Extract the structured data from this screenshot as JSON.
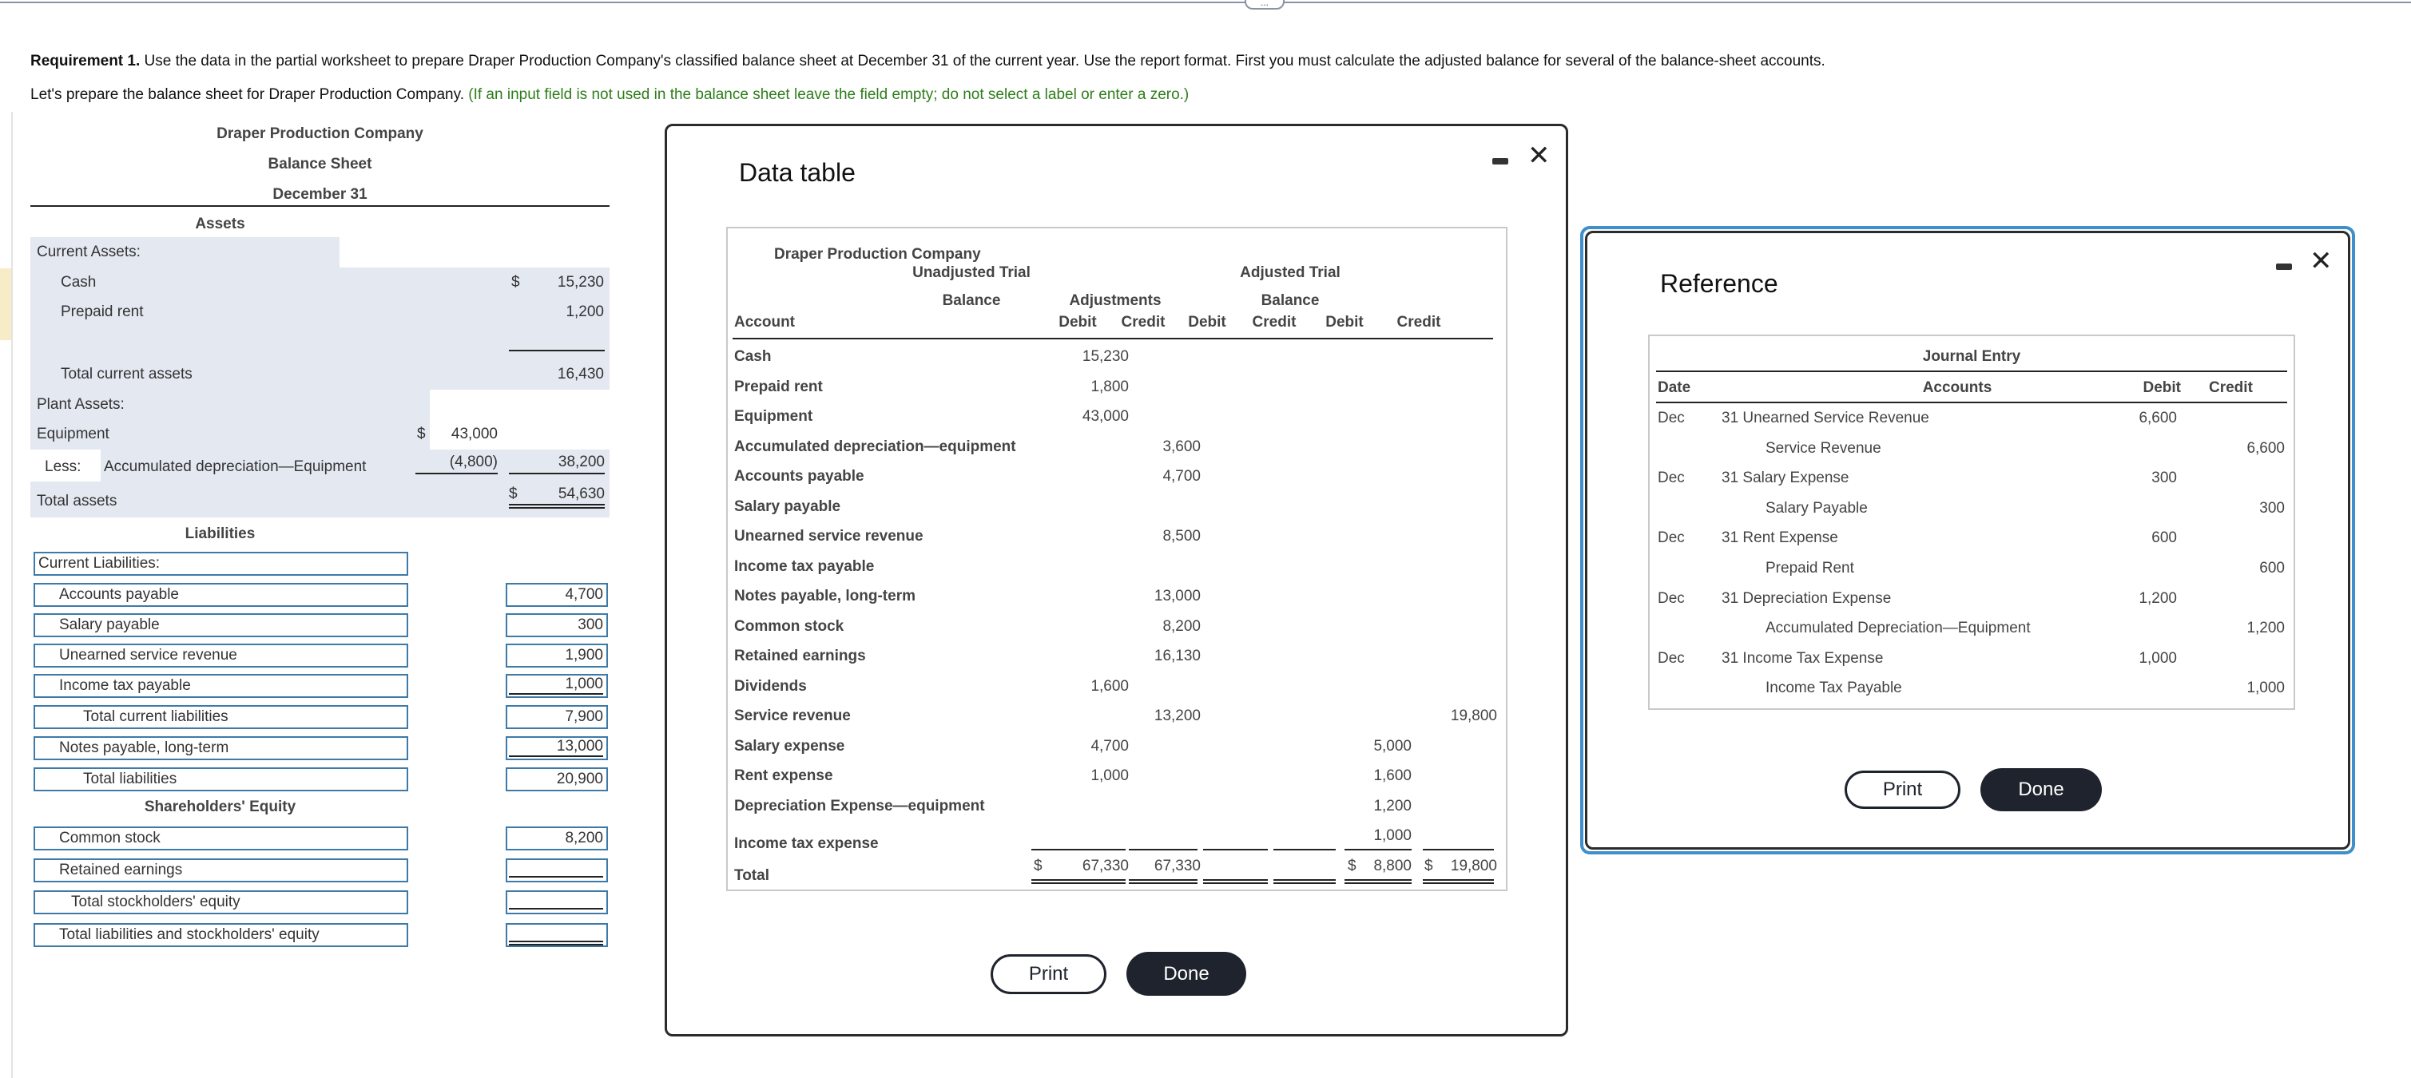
{
  "page": {
    "requirement_label": "Requirement 1.",
    "requirement_text": " Use the data in the partial worksheet to prepare Draper Production Company's classified balance sheet at December 31 of the current year. Use the report format. First you must calculate the adjusted balance for several of the balance-sheet accounts.",
    "intro_text": "Let's prepare the balance sheet for Draper Production Company. ",
    "intro_note": "(If an input field is not used in the balance sheet leave the field empty; do not select a label or enter a zero.)",
    "handle_label": "..."
  },
  "balance_sheet": {
    "company": "Draper Production Company",
    "title": "Balance Sheet",
    "date": "December 31",
    "assets_heading": "Assets",
    "current_assets_label": "Current Assets:",
    "cash_label": "Cash",
    "cash_dollar": "$",
    "cash_value": "15,230",
    "prepaid_label": "Prepaid rent",
    "prepaid_value": "1,200",
    "total_current_assets_label": "Total current assets",
    "total_current_assets_value": "16,430",
    "plant_assets_label": "Plant Assets:",
    "equipment_label": "Equipment",
    "equipment_dollar": "$",
    "equipment_value": "43,000",
    "less_label": "Less:",
    "accum_dep_label": "Accumulated depreciation—Equipment",
    "accum_dep_value": "(4,800)",
    "net_plant_value": "38,200",
    "total_assets_label": "Total assets",
    "total_assets_dollar": "$",
    "total_assets_value": "54,630",
    "liabilities_heading": "Liabilities",
    "current_liabilities_label": "Current Liabilities:",
    "liabilities": [
      {
        "label": "Accounts payable",
        "value": "4,700"
      },
      {
        "label": "Salary payable",
        "value": "300"
      },
      {
        "label": "Unearned service revenue",
        "value": "1,900"
      },
      {
        "label": "Income tax payable",
        "value": "1,000"
      },
      {
        "label": "Total current liabilities",
        "value": "7,900"
      },
      {
        "label": "Notes payable, long-term",
        "value": "13,000"
      },
      {
        "label": "Total liabilities",
        "value": "20,900"
      }
    ],
    "equity_heading": "Shareholders' Equity",
    "equity": [
      {
        "label": "Common stock",
        "value": "8,200"
      },
      {
        "label": "Retained earnings",
        "value": ""
      },
      {
        "label": "Total stockholders' equity",
        "value": ""
      },
      {
        "label": "Total liabilities and stockholders' equity",
        "value": ""
      }
    ]
  },
  "data_table": {
    "title": "Data table",
    "company": "Draper Production Company",
    "group_headers": [
      "Unadjusted Trial Balance",
      "Adjustments",
      "Adjusted Trial Balance"
    ],
    "group_header_lines": [
      [
        "Unadjusted Trial",
        "Balance"
      ],
      [
        "",
        "Adjustments"
      ],
      [
        "Adjusted Trial",
        "Balance"
      ]
    ],
    "column_headers": [
      "Account",
      "Debit",
      "Credit",
      "Debit",
      "Credit",
      "Debit",
      "Credit"
    ],
    "rows": [
      {
        "account": "Cash",
        "utb_debit": "15,230",
        "utb_credit": "",
        "adj_debit": "",
        "adj_credit": "",
        "atb_debit": "",
        "atb_credit": ""
      },
      {
        "account": "Prepaid rent",
        "utb_debit": "1,800",
        "utb_credit": "",
        "adj_debit": "",
        "adj_credit": "",
        "atb_debit": "",
        "atb_credit": ""
      },
      {
        "account": "Equipment",
        "utb_debit": "43,000",
        "utb_credit": "",
        "adj_debit": "",
        "adj_credit": "",
        "atb_debit": "",
        "atb_credit": ""
      },
      {
        "account": "Accumulated depreciation—equipment",
        "utb_debit": "",
        "utb_credit": "3,600",
        "adj_debit": "",
        "adj_credit": "",
        "atb_debit": "",
        "atb_credit": ""
      },
      {
        "account": "Accounts payable",
        "utb_debit": "",
        "utb_credit": "4,700",
        "adj_debit": "",
        "adj_credit": "",
        "atb_debit": "",
        "atb_credit": ""
      },
      {
        "account": "Salary payable",
        "utb_debit": "",
        "utb_credit": "",
        "adj_debit": "",
        "adj_credit": "",
        "atb_debit": "",
        "atb_credit": ""
      },
      {
        "account": "Unearned service revenue",
        "utb_debit": "",
        "utb_credit": "8,500",
        "adj_debit": "",
        "adj_credit": "",
        "atb_debit": "",
        "atb_credit": ""
      },
      {
        "account": "Income tax payable",
        "utb_debit": "",
        "utb_credit": "",
        "adj_debit": "",
        "adj_credit": "",
        "atb_debit": "",
        "atb_credit": ""
      },
      {
        "account": "Notes payable, long-term",
        "utb_debit": "",
        "utb_credit": "13,000",
        "adj_debit": "",
        "adj_credit": "",
        "atb_debit": "",
        "atb_credit": ""
      },
      {
        "account": "Common stock",
        "utb_debit": "",
        "utb_credit": "8,200",
        "adj_debit": "",
        "adj_credit": "",
        "atb_debit": "",
        "atb_credit": ""
      },
      {
        "account": "Retained earnings",
        "utb_debit": "",
        "utb_credit": "16,130",
        "adj_debit": "",
        "adj_credit": "",
        "atb_debit": "",
        "atb_credit": ""
      },
      {
        "account": "Dividends",
        "utb_debit": "1,600",
        "utb_credit": "",
        "adj_debit": "",
        "adj_credit": "",
        "atb_debit": "",
        "atb_credit": ""
      },
      {
        "account": "Service revenue",
        "utb_debit": "",
        "utb_credit": "13,200",
        "adj_debit": "",
        "adj_credit": "",
        "atb_debit": "",
        "atb_credit": "19,800"
      },
      {
        "account": "Salary expense",
        "utb_debit": "4,700",
        "utb_credit": "",
        "adj_debit": "",
        "adj_credit": "",
        "atb_debit": "5,000",
        "atb_credit": ""
      },
      {
        "account": "Rent expense",
        "utb_debit": "1,000",
        "utb_credit": "",
        "adj_debit": "",
        "adj_credit": "",
        "atb_debit": "1,600",
        "atb_credit": ""
      },
      {
        "account": "Depreciation Expense—equipment",
        "utb_debit": "",
        "utb_credit": "",
        "adj_debit": "",
        "adj_credit": "",
        "atb_debit": "1,200",
        "atb_credit": ""
      },
      {
        "account": "Income tax expense",
        "utb_debit": "",
        "utb_credit": "",
        "adj_debit": "",
        "adj_credit": "",
        "atb_debit": "1,000",
        "atb_credit": ""
      }
    ],
    "total": {
      "account": "Total",
      "utb_debit": "67,330",
      "utb_credit": "67,330",
      "adj_debit": "",
      "adj_credit": "",
      "atb_debit": "8,800",
      "atb_credit": "19,800",
      "dollar": "$"
    },
    "print_label": "Print",
    "done_label": "Done"
  },
  "reference": {
    "title": "Reference",
    "table_title": "Journal Entry",
    "headers": [
      "Date",
      "Accounts",
      "Debit",
      "Credit"
    ],
    "entries": [
      {
        "date": "Dec",
        "account": "31 Unearned Service Revenue",
        "debit": "6,600",
        "credit": "",
        "indent": false
      },
      {
        "date": "",
        "account": "Service Revenue",
        "debit": "",
        "credit": "6,600",
        "indent": true
      },
      {
        "date": "Dec",
        "account": "31 Salary Expense",
        "debit": "300",
        "credit": "",
        "indent": false
      },
      {
        "date": "",
        "account": "Salary Payable",
        "debit": "",
        "credit": "300",
        "indent": true
      },
      {
        "date": "Dec",
        "account": "31 Rent Expense",
        "debit": "600",
        "credit": "",
        "indent": false
      },
      {
        "date": "",
        "account": "Prepaid Rent",
        "debit": "",
        "credit": "600",
        "indent": true
      },
      {
        "date": "Dec",
        "account": "31 Depreciation Expense",
        "debit": "1,200",
        "credit": "",
        "indent": false
      },
      {
        "date": "",
        "account": "Accumulated Depreciation—Equipment",
        "debit": "",
        "credit": "1,200",
        "indent": true
      },
      {
        "date": "Dec",
        "account": "31 Income Tax Expense",
        "debit": "1,000",
        "credit": "",
        "indent": false
      },
      {
        "date": "",
        "account": "Income Tax Payable",
        "debit": "",
        "credit": "1,000",
        "indent": true
      }
    ],
    "print_label": "Print",
    "done_label": "Done"
  },
  "colors": {
    "input_border": "#3d7aa8",
    "shaded_bg": "#e3e8f1",
    "note_green": "#2e7d1a",
    "button_dark": "#1f232d",
    "reference_focus": "#3f8fca"
  }
}
